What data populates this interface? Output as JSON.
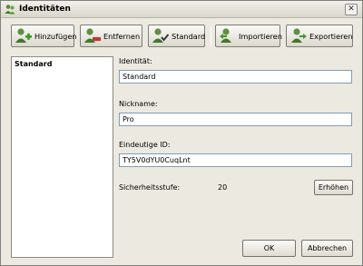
{
  "window": {
    "title": "Identitäten",
    "close_glyph": "✕"
  },
  "toolbar": {
    "add_label": "Hinzufügen",
    "remove_label": "Entfernen",
    "default_label": "Standard",
    "import_label": "Importieren",
    "export_label": "Exportieren"
  },
  "identities": {
    "items": [
      "Standard"
    ],
    "selected": "Standard"
  },
  "form": {
    "identity_label": "Identität:",
    "identity_value": "Standard",
    "nickname_label": "Nickname:",
    "nickname_value": "Pro",
    "unique_id_label": "Eindeutige ID:",
    "unique_id_value": "TY5V0dYU0CuqLnt",
    "security_label": "Sicherheitsstufe:",
    "security_value": "20",
    "raise_label": "Erhöhen"
  },
  "footer": {
    "ok_label": "OK",
    "cancel_label": "Abbrechen"
  },
  "colors": {
    "accent_green": "#3a9a2a",
    "remove_red": "#c8352b",
    "input_border": "#7f9db9"
  },
  "icons": [
    "identities-icon",
    "add-user-icon",
    "remove-user-icon",
    "default-user-icon",
    "import-icon",
    "export-icon",
    "close-icon"
  ]
}
